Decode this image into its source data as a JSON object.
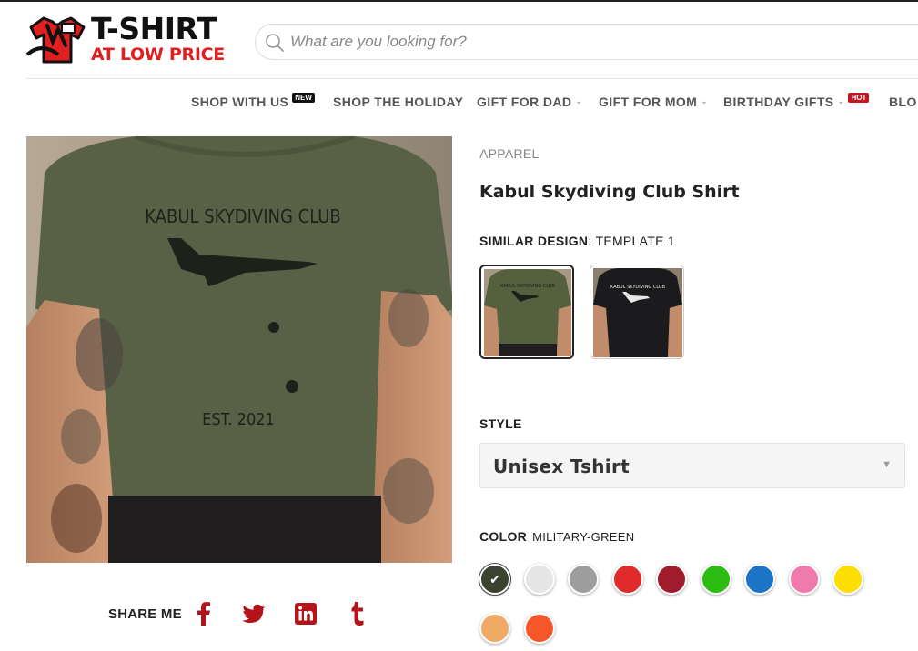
{
  "brand": {
    "logo_line1": "T-SHIRT",
    "logo_line2": "AT LOW PRICE",
    "logo_icon": "tshirt-logo-icon"
  },
  "search": {
    "placeholder": "What are you looking for?",
    "icon": "search-icon"
  },
  "nav": {
    "items": [
      {
        "label": "SHOP WITH US",
        "badge": "NEW",
        "dropdown": false
      },
      {
        "label": "SHOP THE HOLIDAY",
        "dropdown": false
      },
      {
        "label": "GIFT FOR DAD",
        "dropdown": true
      },
      {
        "label": "GIFT FOR MOM",
        "dropdown": true
      },
      {
        "label": "BIRTHDAY GIFTS",
        "dropdown": true,
        "badge": "HOT"
      },
      {
        "label": "BLO",
        "dropdown": false
      }
    ]
  },
  "product": {
    "category": "APPAREL",
    "title": "Kabul Skydiving Club Shirt",
    "print_line1": "KABUL SKYDIVING CLUB",
    "print_line2": "EST. 2021",
    "similar_label": "SIMILAR DESIGN",
    "similar_value": "TEMPLATE 1",
    "thumbnails": [
      {
        "shirt_color": "#55603f",
        "print_color": "#1c1f18",
        "selected": true
      },
      {
        "shirt_color": "#1b1b1d",
        "print_color": "#e8e8e8",
        "selected": false
      }
    ],
    "style_label": "STYLE",
    "style_value": "Unisex Tshirt",
    "color_label": "COLOR",
    "color_value": "MILITARY-GREEN",
    "swatches": [
      {
        "name": "military-green",
        "hex": "#3c4230",
        "selected": true
      },
      {
        "name": "white",
        "hex": "#e5e5e5",
        "selected": false
      },
      {
        "name": "grey",
        "hex": "#9e9e9e",
        "selected": false
      },
      {
        "name": "red",
        "hex": "#e12a2a",
        "selected": false
      },
      {
        "name": "maroon",
        "hex": "#a01c2c",
        "selected": false
      },
      {
        "name": "green",
        "hex": "#2dbd12",
        "selected": false
      },
      {
        "name": "blue",
        "hex": "#1d74c6",
        "selected": false
      },
      {
        "name": "pink",
        "hex": "#f07aae",
        "selected": false
      },
      {
        "name": "yellow",
        "hex": "#fedd00",
        "selected": false
      },
      {
        "name": "orange",
        "hex": "#eeaa66",
        "selected": false
      },
      {
        "name": "orange-red",
        "hex": "#f5572a",
        "selected": false
      }
    ]
  },
  "share": {
    "label": "SHARE ME",
    "icons": [
      "facebook-icon",
      "twitter-icon",
      "linkedin-icon",
      "tumblr-icon"
    ],
    "icon_color": "#b3141b"
  }
}
